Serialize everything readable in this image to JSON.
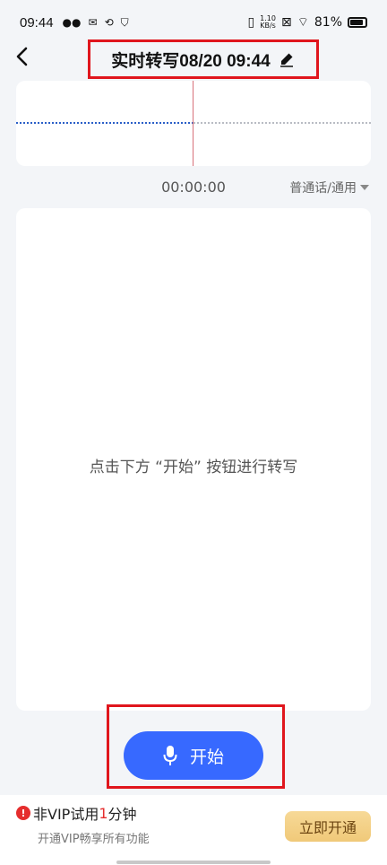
{
  "status_bar": {
    "time": "09:44",
    "net_speed_value": "1.10",
    "net_speed_unit": "KB/s",
    "battery": "81%"
  },
  "header": {
    "title": "实时转写08/20 09:44"
  },
  "recorder": {
    "timer": "00:00:00",
    "language": "普通话/通用"
  },
  "transcript": {
    "hint": "点击下方 “开始” 按钮进行转写"
  },
  "actions": {
    "start_label": "开始"
  },
  "vip": {
    "title_prefix": "非VIP试用",
    "title_num": "1",
    "title_suffix": "分钟",
    "subtitle": "开通VIP畅享所有功能",
    "button": "立即开通"
  },
  "colors": {
    "accent": "#3769ff",
    "highlight_box": "#e0161d",
    "warning": "#e52d2d",
    "vip_button": "#f3cf86"
  },
  "icons": [
    "back-chevron-icon",
    "edit-pen-icon",
    "microphone-icon",
    "dropdown-triangle-icon",
    "warning-icon"
  ]
}
